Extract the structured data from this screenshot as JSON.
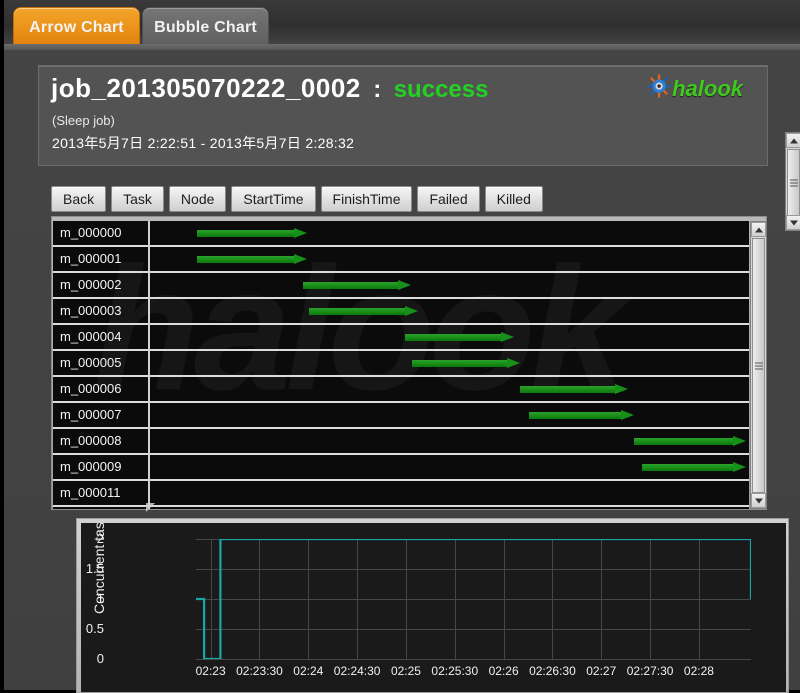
{
  "tabs": [
    {
      "label": "Arrow Chart",
      "active": true
    },
    {
      "label": "Bubble Chart",
      "active": false
    }
  ],
  "header": {
    "job_id": "job_201305070222_0002",
    "separator": ":",
    "status": "success",
    "status_color": "#24d024",
    "subtitle": "(Sleep job)",
    "time_range": "2013年5月7日 2:22:51 - 2013年5月7日 2:28:32",
    "logo_text": "halook",
    "logo_icon": "gear-sun-icon"
  },
  "toolbar": {
    "buttons": [
      "Back",
      "Task",
      "Node",
      "StartTime",
      "FinishTime",
      "Failed",
      "Killed"
    ]
  },
  "arrow_chart": {
    "watermark": "halook",
    "arrow_color": "#1b8a1b",
    "rows": [
      {
        "label": "m_000000",
        "start": 7.8,
        "end": 26.2
      },
      {
        "label": "m_000001",
        "start": 7.8,
        "end": 26.2
      },
      {
        "label": "m_000002",
        "start": 25.5,
        "end": 43.5
      },
      {
        "label": "m_000003",
        "start": 26.5,
        "end": 44.8
      },
      {
        "label": "m_000004",
        "start": 42.5,
        "end": 60.7
      },
      {
        "label": "m_000005",
        "start": 43.8,
        "end": 61.8
      },
      {
        "label": "m_000006",
        "start": 61.8,
        "end": 79.8
      },
      {
        "label": "m_000007",
        "start": 63.2,
        "end": 80.8
      },
      {
        "label": "m_000008",
        "start": 80.8,
        "end": 99.5
      },
      {
        "label": "m_000009",
        "start": 82.2,
        "end": 99.5
      },
      {
        "label": "m_000011",
        "start": null,
        "end": null
      }
    ]
  },
  "chart_data": {
    "type": "line",
    "title": "",
    "xlabel": "",
    "ylabel": "Concurrent task num",
    "ylim": [
      0,
      2
    ],
    "yticks": [
      "0",
      "0.5",
      "1",
      "1.5",
      "2"
    ],
    "ytick_values": [
      0,
      0.5,
      1,
      1.5,
      2
    ],
    "xticks": [
      "02:23",
      "02:23:30",
      "02:24",
      "02:24:30",
      "02:25",
      "02:25:30",
      "02:26",
      "02:26:30",
      "02:27",
      "02:27:30",
      "02:28"
    ],
    "xlim": [
      "02:22:51",
      "02:28:32"
    ],
    "grid": true,
    "legend": false,
    "line_color": "#16a8a8",
    "series": [
      {
        "name": "Concurrent task num",
        "x": [
          "02:22:51",
          "02:22:56",
          "02:23:02",
          "02:23:06",
          "02:28:11",
          "02:28:32"
        ],
        "values": [
          1,
          0,
          0,
          2,
          2,
          1
        ]
      }
    ]
  },
  "scrollbars": {
    "header_scrollbar": "vertical",
    "gantt_scrollbar": "vertical"
  }
}
